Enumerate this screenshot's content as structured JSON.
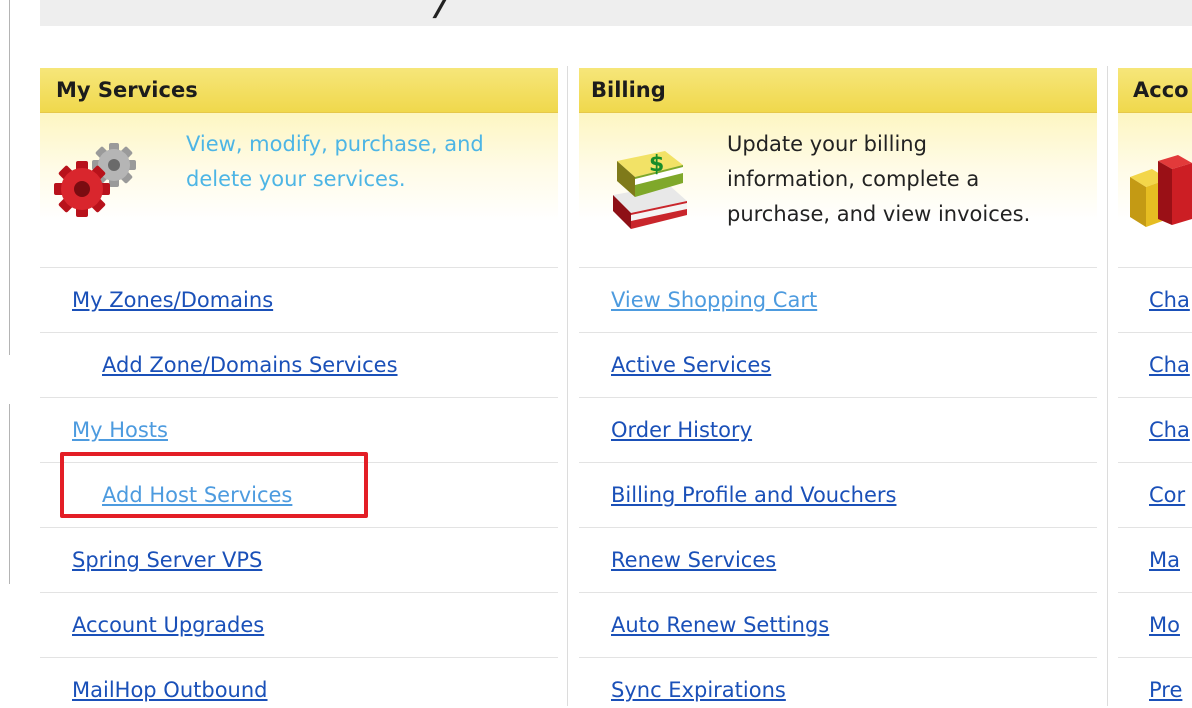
{
  "top_bar": {
    "cut_glyph": "/"
  },
  "my_services": {
    "title": "My Services",
    "description": "View, modify, purchase, and delete your services.",
    "description_lines": [
      "View, modify, purchase, and",
      "delete your services."
    ],
    "icon": "gears-icon",
    "links": [
      {
        "label": "My Zones/Domains",
        "color": "#1a50b8",
        "indent": false
      },
      {
        "label": "Add Zone/Domains Services",
        "color": "#1a50b8",
        "indent": true
      },
      {
        "label": "My Hosts",
        "color": "#4d9bdf",
        "indent": false
      },
      {
        "label": "Add Host Services",
        "color": "#4d9bdf",
        "indent": true,
        "highlighted": true
      },
      {
        "label": "Spring Server VPS",
        "color": "#1a50b8",
        "indent": false
      },
      {
        "label": "Account Upgrades",
        "color": "#1a50b8",
        "indent": false
      },
      {
        "label": "MailHop Outbound",
        "color": "#1a50b8",
        "indent": false
      }
    ]
  },
  "billing": {
    "title": "Billing",
    "description": "Update your billing information, complete a purchase, and view invoices.",
    "description_lines": [
      "Update your billing",
      "information, complete a",
      "purchase, and view invoices."
    ],
    "icon": "books-dollar-icon",
    "links": [
      {
        "label": "View Shopping Cart",
        "color": "#4d9bdf"
      },
      {
        "label": "Active Services",
        "color": "#1a50b8"
      },
      {
        "label": "Order History",
        "color": "#1a50b8"
      },
      {
        "label": "Billing Profile and Vouchers",
        "color": "#1a50b8"
      },
      {
        "label": "Renew Services",
        "color": "#1a50b8"
      },
      {
        "label": "Auto Renew Settings",
        "color": "#1a50b8"
      },
      {
        "label": "Sync Expirations",
        "color": "#1a50b8"
      }
    ]
  },
  "account": {
    "title": "Acco",
    "icon": "account-blocks-icon",
    "links": [
      "Cha",
      "Cha",
      "Cha",
      "Cor",
      "Ma",
      "Mo",
      "Pre"
    ]
  },
  "colors": {
    "header_yellow": "#f0d84c",
    "link_dark": "#1a50b8",
    "link_light": "#4d9bdf",
    "highlight_red": "#e31e26"
  }
}
